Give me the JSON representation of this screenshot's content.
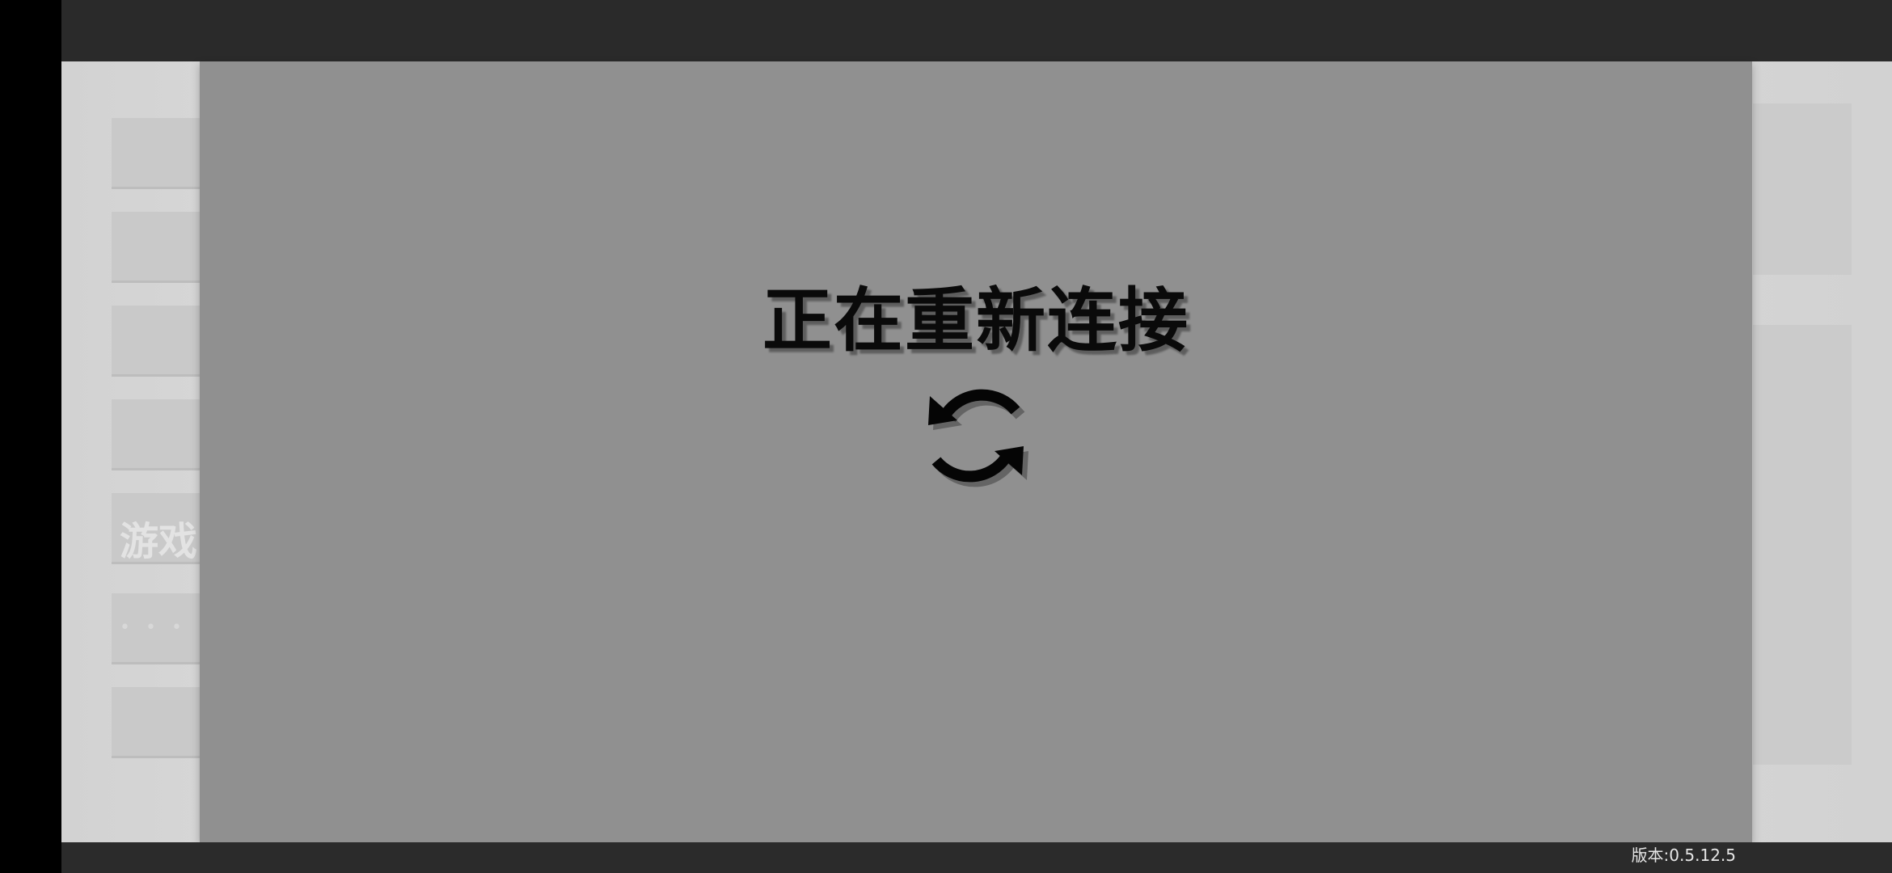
{
  "dialog": {
    "title": "正在重新连接",
    "icon": "refresh-icon"
  },
  "footer": {
    "version": "版本:0.5.12.5"
  },
  "background_menu": {
    "items": [
      {
        "label": ""
      },
      {
        "label": ""
      },
      {
        "label": ""
      },
      {
        "label": ""
      },
      {
        "label": "游戏"
      },
      {
        "label": ""
      },
      {
        "label": ""
      }
    ]
  },
  "colors": {
    "top_bar": "#2a2a2a",
    "overlay": "#909090",
    "title_text": "#0a0a0a",
    "version_text": "#e6e6e6"
  }
}
